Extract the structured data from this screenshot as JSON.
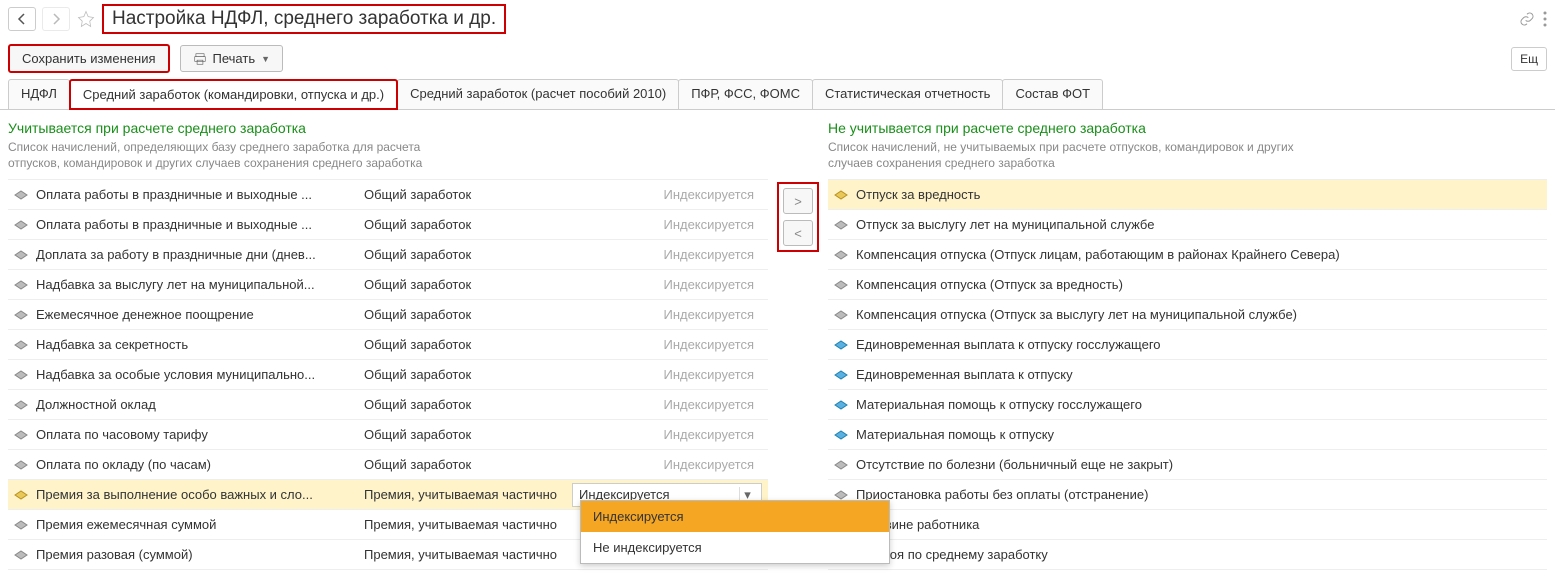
{
  "header": {
    "title": "Настройка НДФЛ, среднего заработка и др."
  },
  "toolbar": {
    "save": "Сохранить изменения",
    "print": "Печать",
    "more": "Ещ"
  },
  "tabs": [
    "НДФЛ",
    "Средний заработок (командировки, отпуска и др.)",
    "Средний заработок (расчет пособий 2010)",
    "ПФР, ФСС, ФОМС",
    "Статистическая отчетность",
    "Состав ФОТ"
  ],
  "left": {
    "title": "Учитывается при расчете среднего заработка",
    "desc": "Список начислений, определяющих базу среднего заработка для расчета отпусков, командировок и других случаев сохранения среднего заработка",
    "rows": [
      {
        "name": "Оплата работы в праздничные и выходные ...",
        "type": "Общий заработок",
        "idx": "Индексируется",
        "sel": false,
        "icon": "g"
      },
      {
        "name": "Оплата работы в праздничные и выходные ...",
        "type": "Общий заработок",
        "idx": "Индексируется",
        "sel": false,
        "icon": "g"
      },
      {
        "name": "Доплата за работу в праздничные дни (днев...",
        "type": "Общий заработок",
        "idx": "Индексируется",
        "sel": false,
        "icon": "g"
      },
      {
        "name": "Надбавка за выслугу лет на муниципальной...",
        "type": "Общий заработок",
        "idx": "Индексируется",
        "sel": false,
        "icon": "g"
      },
      {
        "name": "Ежемесячное денежное поощрение",
        "type": "Общий заработок",
        "idx": "Индексируется",
        "sel": false,
        "icon": "g"
      },
      {
        "name": "Надбавка за секретность",
        "type": "Общий заработок",
        "idx": "Индексируется",
        "sel": false,
        "icon": "g"
      },
      {
        "name": "Надбавка за особые условия муниципально...",
        "type": "Общий заработок",
        "idx": "Индексируется",
        "sel": false,
        "icon": "g"
      },
      {
        "name": "Должностной оклад",
        "type": "Общий заработок",
        "idx": "Индексируется",
        "sel": false,
        "icon": "g"
      },
      {
        "name": "Оплата по часовому тарифу",
        "type": "Общий заработок",
        "idx": "Индексируется",
        "sel": false,
        "icon": "g"
      },
      {
        "name": "Оплата по окладу (по часам)",
        "type": "Общий заработок",
        "idx": "Индексируется",
        "sel": false,
        "icon": "g"
      },
      {
        "name": "Премия за выполнение особо важных и сло...",
        "type": "Премия, учитываемая частично",
        "idx": "Индексируется",
        "sel": true,
        "icon": "y"
      },
      {
        "name": "Премия ежемесячная суммой",
        "type": "Премия, учитываемая частично",
        "idx": "",
        "sel": false,
        "icon": "g"
      },
      {
        "name": "Премия разовая (суммой)",
        "type": "Премия, учитываемая частично",
        "idx": "",
        "sel": false,
        "icon": "g"
      }
    ]
  },
  "right": {
    "title": "Не учитывается при расчете среднего заработка",
    "desc": "Список начислений, не учитываемых при расчете отпусков, командировок и других случаев сохранения среднего заработка",
    "rows": [
      {
        "name": "Отпуск за вредность",
        "sel": true,
        "icon": "y"
      },
      {
        "name": "Отпуск за выслугу лет на муниципальной службе",
        "sel": false,
        "icon": "g"
      },
      {
        "name": "Компенсация отпуска (Отпуск лицам, работающим в районах Крайнего Севера)",
        "sel": false,
        "icon": "g"
      },
      {
        "name": "Компенсация отпуска (Отпуск за вредность)",
        "sel": false,
        "icon": "g"
      },
      {
        "name": "Компенсация отпуска (Отпуск за выслугу лет на муниципальной службе)",
        "sel": false,
        "icon": "g"
      },
      {
        "name": "Единовременная выплата к отпуску госслужащего",
        "sel": false,
        "icon": "b"
      },
      {
        "name": "Единовременная выплата к отпуску",
        "sel": false,
        "icon": "b"
      },
      {
        "name": "Материальная помощь к отпуску госслужащего",
        "sel": false,
        "icon": "b"
      },
      {
        "name": "Материальная помощь к отпуску",
        "sel": false,
        "icon": "b"
      },
      {
        "name": "Отсутствие по болезни (больничный еще не закрыт)",
        "sel": false,
        "icon": "g"
      },
      {
        "name": "Приостановка работы без оплаты (отстранение)",
        "sel": false,
        "icon": "g"
      },
      {
        "name": "й по вине работника",
        "sel": false,
        "icon": "g"
      },
      {
        "name": "простоя по среднему заработку",
        "sel": false,
        "icon": "g"
      }
    ]
  },
  "dropdown": {
    "opt1": "Индексируется",
    "opt2": "Не индексируется"
  }
}
